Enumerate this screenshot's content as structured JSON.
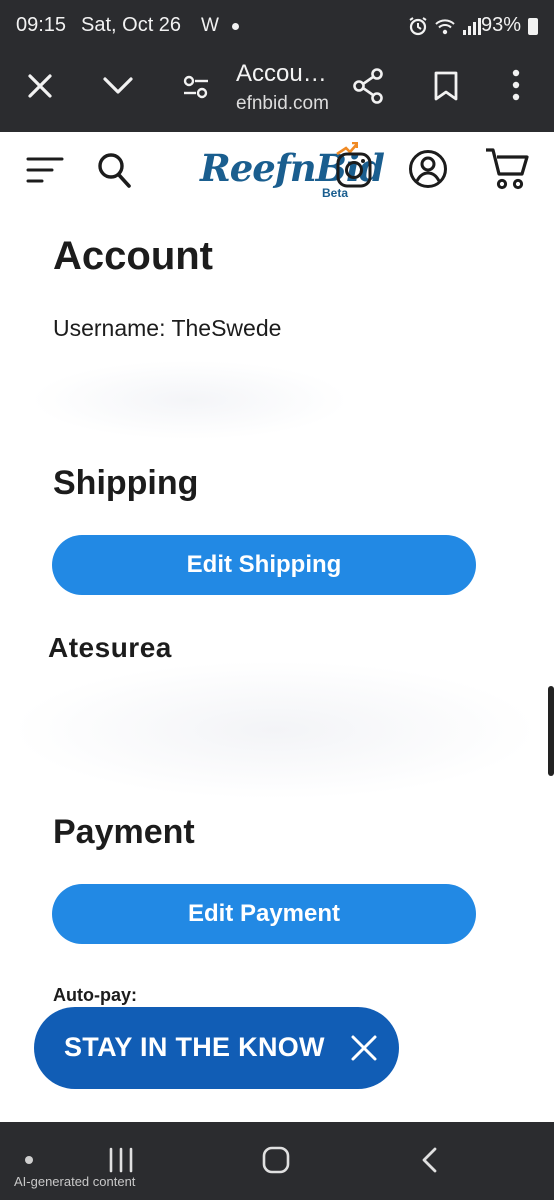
{
  "status_bar": {
    "time": "09:15",
    "date": "Sat, Oct 26",
    "app_letter": "W",
    "battery": "93%",
    "icons": [
      "alarm-icon",
      "wifi-icon",
      "signal-icon",
      "battery-icon"
    ]
  },
  "browser": {
    "page_title": "Accou…",
    "url": "efnbid.com",
    "icons": [
      "close-icon",
      "chevron-down-icon",
      "page-settings-icon",
      "share-icon",
      "bookmark-icon",
      "more-icon"
    ]
  },
  "site_header": {
    "logo_text": "ReefnBid",
    "logo_badge": "Beta",
    "icons": [
      "menu-icon",
      "search-icon",
      "instagram-icon",
      "account-icon",
      "cart-icon"
    ],
    "colors": {
      "logo_blue": "#1a5e8f",
      "logo_orange": "#f08a24"
    }
  },
  "account": {
    "heading": "Account",
    "username": "Username: TheSwede"
  },
  "shipping": {
    "heading": "Shipping",
    "edit_button": "Edit Shipping",
    "address_label": "Atesurea"
  },
  "payment": {
    "heading": "Payment",
    "edit_button": "Edit Payment",
    "autopay_label": "Auto-pay:"
  },
  "stay_in_the_know": {
    "label": "STAY IN THE KNOW",
    "color": "#115db5"
  },
  "nav_bar": {
    "ai_label": "AI-generated content",
    "icons": [
      "recents-icon",
      "home-icon",
      "back-icon"
    ]
  },
  "colors": {
    "primary_button": "#2289e4",
    "system_bar": "#2b2c2f"
  }
}
